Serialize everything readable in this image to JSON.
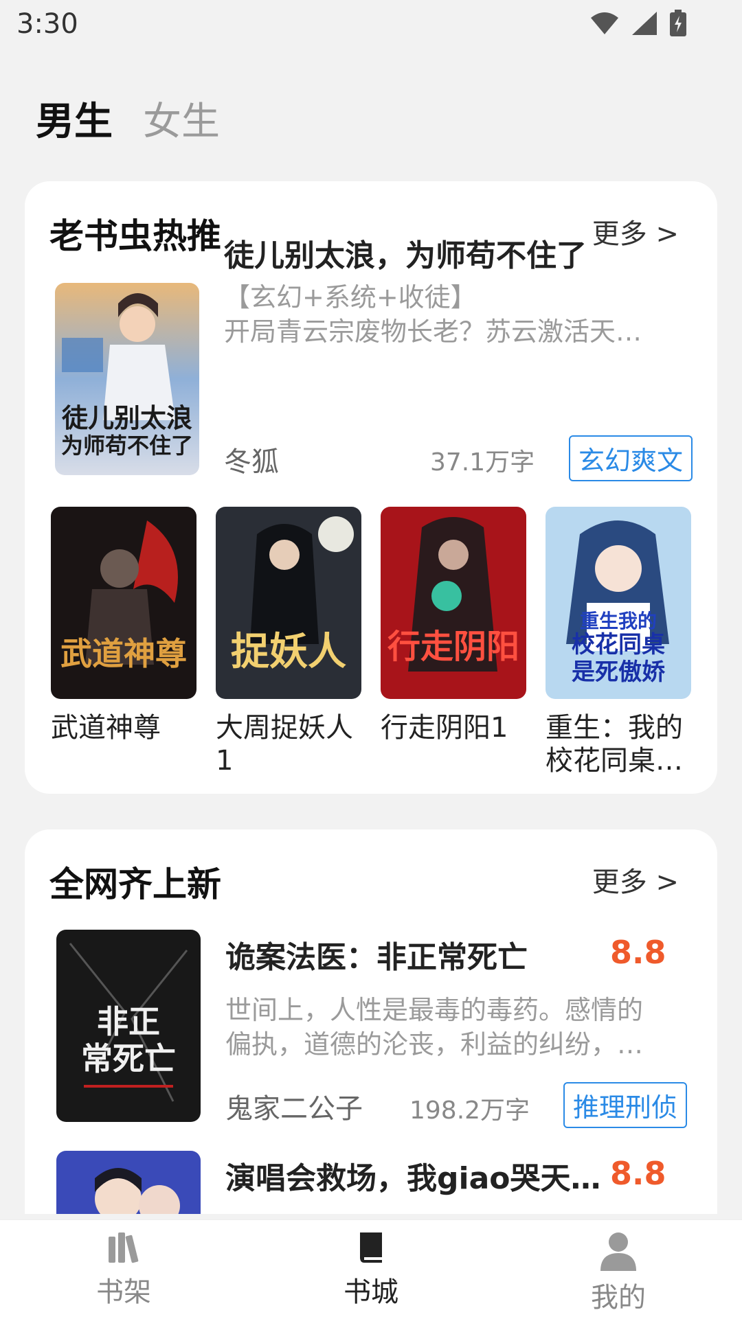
{
  "status_bar": {
    "time": "3:30",
    "icons": [
      "wifi-icon",
      "signal-icon",
      "battery-charging-icon"
    ]
  },
  "gender_tabs": [
    {
      "label": "男生",
      "active": true
    },
    {
      "label": "女生",
      "active": false
    }
  ],
  "section_hot": {
    "title": "老书虫热推",
    "more": "更多 >",
    "featured": {
      "title": "徒儿别太浪，为师苟不住了",
      "desc_line1": "【玄幻+系统+收徒】",
      "desc_line2": "开局青云宗废物长老？苏云激活天…",
      "author": "冬狐",
      "words": "37.1万字",
      "tag": "玄幻爽文",
      "cover_text": "徒儿别太浪为师苟不住了"
    },
    "grid": [
      {
        "name": "武道神尊",
        "cover_text": "武道神尊"
      },
      {
        "name": "大周捉妖人1",
        "cover_text": "捉妖人"
      },
      {
        "name": "行走阴阳1",
        "cover_text": "行走阴阳"
      },
      {
        "name": "重生：我的校花同桌…",
        "cover_text": "重生我的校花同桌"
      }
    ]
  },
  "section_new": {
    "title": "全网齐上新",
    "more": "更多 >",
    "books": [
      {
        "title": "诡案法医：非正常死亡",
        "score": "8.8",
        "desc_line1": "世间上，人性是最毒的毒药。感情的",
        "desc_line2": "偏执，道德的沦丧，利益的纠纷，…",
        "author": "鬼家二公子",
        "words": "198.2万字",
        "tag": "推理刑侦",
        "cover_text": "非正常死亡"
      },
      {
        "title": "演唱会救场，我giao哭天…",
        "score": "8.8"
      }
    ]
  },
  "bottom_nav": [
    {
      "label": "书架",
      "icon": "bookshelf-icon",
      "active": false
    },
    {
      "label": "书城",
      "icon": "book-icon",
      "active": true
    },
    {
      "label": "我的",
      "icon": "user-icon",
      "active": false
    }
  ],
  "colors": {
    "accent_blue": "#2a8ae6",
    "score_orange": "#ef5a2b"
  }
}
